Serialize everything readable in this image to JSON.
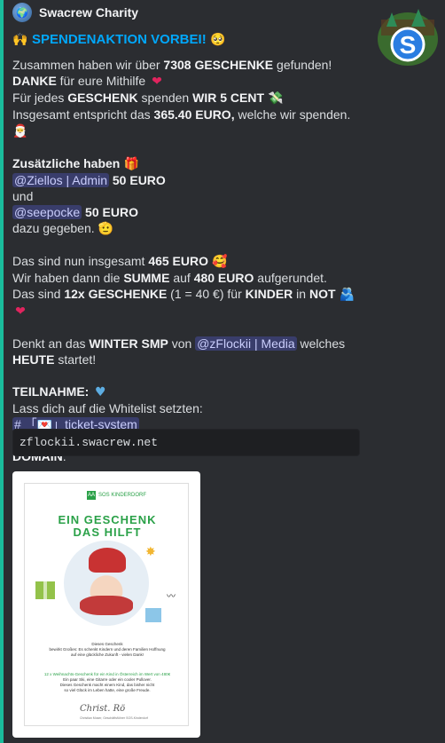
{
  "author": {
    "name": "Swacrew Charity",
    "avatar_icon": "globe-avatar-icon"
  },
  "thumbnail": {
    "letter": "S",
    "accent": "#1e90ff"
  },
  "title": {
    "icon": "raised-hands-icon",
    "text": "SPENDENAKTION VORBEI!",
    "emoji": "pleading-face-icon"
  },
  "p1": {
    "a": "Zusammen haben wir über ",
    "b": "7308 GESCHENKE",
    "c": " gefunden!",
    "d": "DANKE",
    "e": " für eure Mithilfe ",
    "f": "Für jedes ",
    "g": "GESCHENK",
    "h": " spenden ",
    "i": "WIR 5 CENT",
    "j": "Insgesamt entspricht das ",
    "k": "365.40 EURO,",
    "l": " welche wir spenden. "
  },
  "p2": {
    "a": "Zusätzliche haben ",
    "mention1": "@Ziellos | Admin",
    "amount1": "50 EURO",
    "und": "und",
    "mention2": "@seepocke",
    "amount2": "50 EURO",
    "end": "dazu gegeben. "
  },
  "p3": {
    "a": "Das sind nun insgesamt ",
    "b": "465 EURO",
    "c": "Wir haben dann die ",
    "d": "SUMME",
    "e": " auf ",
    "f": "480 EURO",
    "g": " aufgerundet.",
    "h": "Das sind ",
    "i": "12x GESCHENKE",
    "j": " (1 = 40 €) für ",
    "k": "KINDER",
    "l": " in ",
    "m": "NOT"
  },
  "p4": {
    "a": "Denkt an das ",
    "b": "WINTER SMP",
    "c": " von ",
    "mention": "@zFlockii | Media",
    "d": " welches",
    "e": "HEUTE",
    "f": " startet!"
  },
  "p5": {
    "a": "TEILNAHME:",
    "b": "Lass dich auf die Whitelist setzten:",
    "channel": "# 「💌」ticket-system"
  },
  "domain": {
    "label": "DOMAIN",
    "colon": ":",
    "value": "zflockii.swacrew.net"
  },
  "card": {
    "logo": "SOS KINDERDORF",
    "title1": "EIN GESCHENK",
    "title2": "DAS HILFT",
    "t1": "Dieses Geschenk",
    "t2": "bewirkt Großes: Es schenkt Kindern und deren Familien Hoffnung",
    "t3": "auf eine glückliche Zukunft - vielen Dank!",
    "g1": "12 x Weihnachts-Geschenk für ein Kind in Österreich im Wert von 480€",
    "t4": "Ein paar Ski, eine Gitarre oder ein cooler Pullover.",
    "t5": "Dieses Geschenk macht einem Kind, das bisher nicht",
    "t6": "so viel Glück im Leben hatte, eine große Freude.",
    "sig": "Christ. Rö",
    "sigline": "Christian Moser, Geschäftsführer SOS-Kinderdorf"
  }
}
